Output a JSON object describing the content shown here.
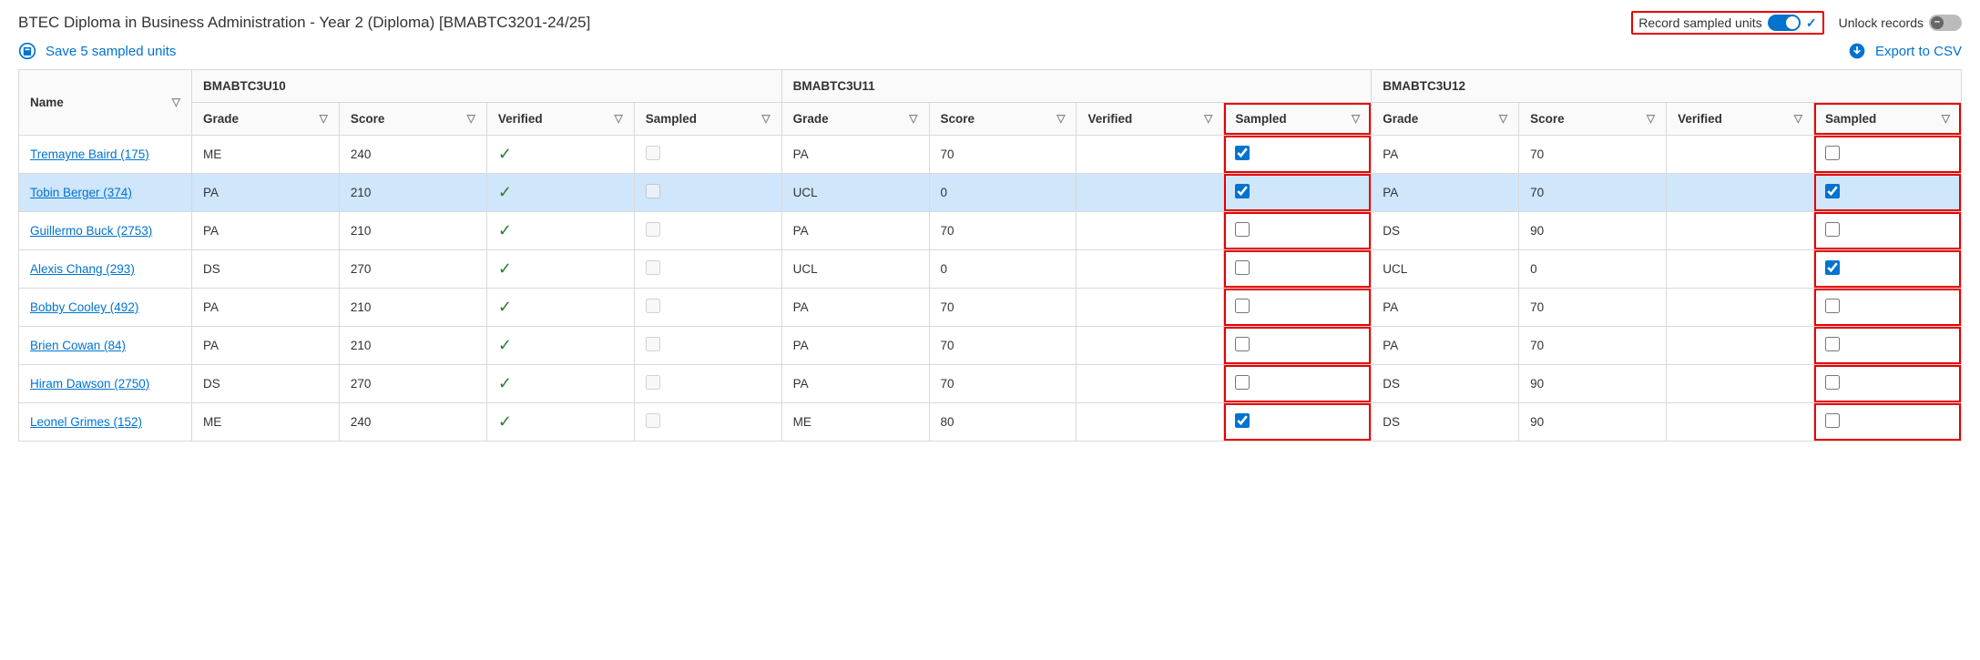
{
  "header": {
    "title": "BTEC Diploma in Business Administration - Year 2 (Diploma) [BMABTC3201-24/25]",
    "record_sampled_label": "Record sampled units",
    "record_sampled_on": true,
    "unlock_records_label": "Unlock records",
    "unlock_records_on": false
  },
  "actions": {
    "save_label": "Save 5 sampled units",
    "export_label": "Export to CSV"
  },
  "columns": {
    "name_header": "Name",
    "sub_headers": [
      "Grade",
      "Score",
      "Verified",
      "Sampled"
    ],
    "unit_groups": [
      "BMABTC3U10",
      "BMABTC3U11",
      "BMABTC3U12"
    ]
  },
  "highlight": {
    "red_sampled_cols": [
      "u11",
      "u12"
    ],
    "red_header_toggle": true
  },
  "rows": [
    {
      "id": "tremayne",
      "name": "Tremayne Baird (175)",
      "selected": false,
      "u10": {
        "grade": "ME",
        "score": "240",
        "verified": true,
        "sampled": false,
        "sampled_disabled": true
      },
      "u11": {
        "grade": "PA",
        "score": "70",
        "verified": false,
        "sampled": true
      },
      "u12": {
        "grade": "PA",
        "score": "70",
        "verified": false,
        "sampled": false
      }
    },
    {
      "id": "tobin",
      "name": "Tobin Berger (374)",
      "selected": true,
      "u10": {
        "grade": "PA",
        "score": "210",
        "verified": true,
        "sampled": false,
        "sampled_disabled": true
      },
      "u11": {
        "grade": "UCL",
        "score": "0",
        "verified": false,
        "sampled": true
      },
      "u12": {
        "grade": "PA",
        "score": "70",
        "verified": false,
        "sampled": true
      }
    },
    {
      "id": "guillermo",
      "name": "Guillermo Buck (2753)",
      "selected": false,
      "u10": {
        "grade": "PA",
        "score": "210",
        "verified": true,
        "sampled": false,
        "sampled_disabled": true
      },
      "u11": {
        "grade": "PA",
        "score": "70",
        "verified": false,
        "sampled": false
      },
      "u12": {
        "grade": "DS",
        "score": "90",
        "verified": false,
        "sampled": false
      }
    },
    {
      "id": "alexis",
      "name": "Alexis Chang (293)",
      "selected": false,
      "u10": {
        "grade": "DS",
        "score": "270",
        "verified": true,
        "sampled": false,
        "sampled_disabled": true
      },
      "u11": {
        "grade": "UCL",
        "score": "0",
        "verified": false,
        "sampled": false
      },
      "u12": {
        "grade": "UCL",
        "score": "0",
        "verified": false,
        "sampled": true
      }
    },
    {
      "id": "bobby",
      "name": "Bobby Cooley (492)",
      "selected": false,
      "u10": {
        "grade": "PA",
        "score": "210",
        "verified": true,
        "sampled": false,
        "sampled_disabled": true
      },
      "u11": {
        "grade": "PA",
        "score": "70",
        "verified": false,
        "sampled": false
      },
      "u12": {
        "grade": "PA",
        "score": "70",
        "verified": false,
        "sampled": false
      }
    },
    {
      "id": "brien",
      "name": "Brien Cowan (84)",
      "selected": false,
      "u10": {
        "grade": "PA",
        "score": "210",
        "verified": true,
        "sampled": false,
        "sampled_disabled": true
      },
      "u11": {
        "grade": "PA",
        "score": "70",
        "verified": false,
        "sampled": false
      },
      "u12": {
        "grade": "PA",
        "score": "70",
        "verified": false,
        "sampled": false
      }
    },
    {
      "id": "hiram",
      "name": "Hiram Dawson (2750)",
      "selected": false,
      "u10": {
        "grade": "DS",
        "score": "270",
        "verified": true,
        "sampled": false,
        "sampled_disabled": true
      },
      "u11": {
        "grade": "PA",
        "score": "70",
        "verified": false,
        "sampled": false
      },
      "u12": {
        "grade": "DS",
        "score": "90",
        "verified": false,
        "sampled": false
      }
    },
    {
      "id": "leonel",
      "name": "Leonel Grimes (152)",
      "selected": false,
      "u10": {
        "grade": "ME",
        "score": "240",
        "verified": true,
        "sampled": false,
        "sampled_disabled": true
      },
      "u11": {
        "grade": "ME",
        "score": "80",
        "verified": false,
        "sampled": true
      },
      "u12": {
        "grade": "DS",
        "score": "90",
        "verified": false,
        "sampled": false
      }
    }
  ]
}
